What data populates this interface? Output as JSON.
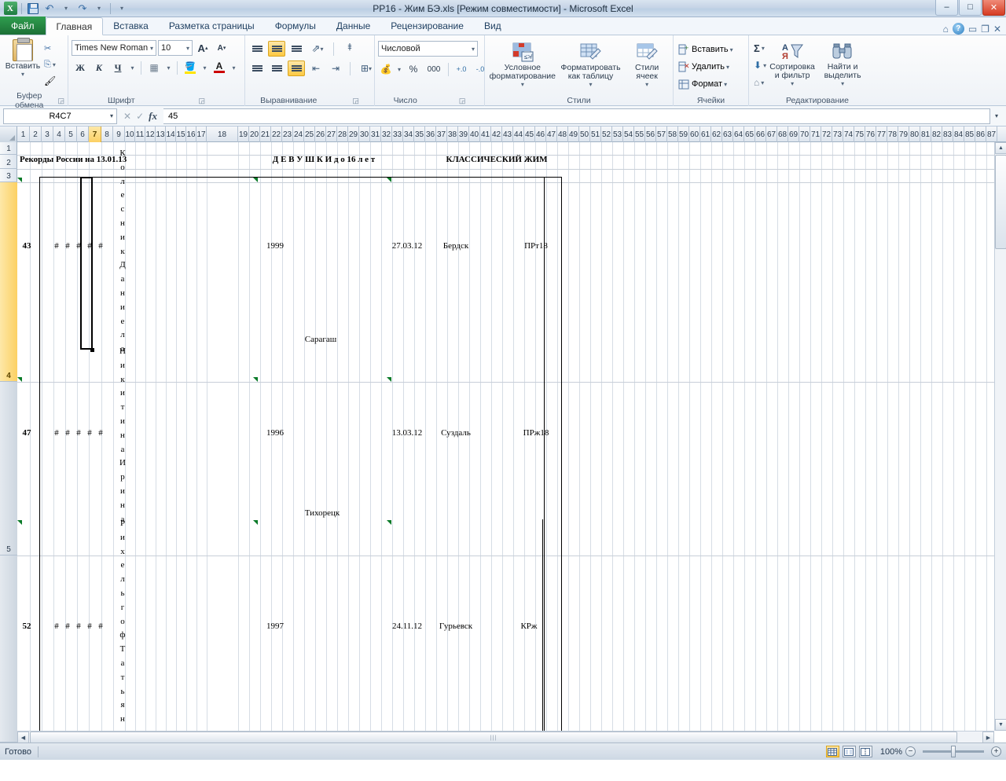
{
  "window": {
    "title": "PP16 - Жим БЭ.xls  [Режим совместимости]  -  Microsoft Excel",
    "minimize": "–",
    "maximize": "□",
    "close": "✕"
  },
  "quick_access": {
    "logo": "X",
    "save": "save-icon",
    "undo": "↶",
    "redo": "↷",
    "customize": "▾"
  },
  "tabs": [
    {
      "label": "Файл",
      "kind": "file"
    },
    {
      "label": "Главная",
      "kind": "active"
    },
    {
      "label": "Вставка",
      "kind": "normal"
    },
    {
      "label": "Разметка страницы",
      "kind": "normal"
    },
    {
      "label": "Формулы",
      "kind": "normal"
    },
    {
      "label": "Данные",
      "kind": "normal"
    },
    {
      "label": "Рецензирование",
      "kind": "normal"
    },
    {
      "label": "Вид",
      "kind": "normal"
    }
  ],
  "ribbon": {
    "clipboard": {
      "group_label": "Буфер обмена",
      "paste": "Вставить",
      "cut": "✂",
      "copy": "⎘",
      "format_painter": "🖌"
    },
    "font": {
      "group_label": "Шрифт",
      "font_name": "Times New Roman",
      "font_size": "10",
      "grow_font": "A",
      "shrink_font": "A",
      "bold": "Ж",
      "italic": "К",
      "underline": "Ч",
      "borders": "▦",
      "fill_color": "A",
      "font_color": "A"
    },
    "alignment": {
      "group_label": "Выравнивание",
      "align_top": "≡",
      "align_middle": "≡",
      "align_bottom": "≡",
      "orientation": "⇗",
      "align_left": "≡",
      "align_center": "≡",
      "align_right": "≡",
      "decrease_indent": "⇤",
      "increase_indent": "⇥",
      "wrap_text": "⮐",
      "merge_cells": "⊞"
    },
    "number": {
      "group_label": "Число",
      "format": "Числовой",
      "currency": "¤",
      "percent": "%",
      "comma": "000",
      "increase_decimal": "+.0",
      "decrease_decimal": "-.0"
    },
    "styles": {
      "group_label": "Стили",
      "conditional": "Условное форматирование",
      "as_table": "Форматировать как таблицу",
      "cell_styles": "Стили ячеек"
    },
    "cells": {
      "group_label": "Ячейки",
      "insert": "Вставить",
      "delete": "Удалить",
      "format": "Формат"
    },
    "editing": {
      "group_label": "Редактирование",
      "autosum": "Σ",
      "fill": "⬇",
      "clear": "⌫",
      "sort_filter": "Сортировка и фильтр",
      "find_select": "Найти и выделить"
    }
  },
  "formula_bar": {
    "name_box": "R4C7",
    "cancel": "✕",
    "enter": "✓",
    "fx": "fx",
    "value": "45",
    "expand": "▾"
  },
  "grid": {
    "column_headers": [
      "1",
      "2",
      "3",
      "4",
      "5",
      "6",
      "7",
      "8",
      "9",
      "10",
      "11",
      "12",
      "13",
      "14",
      "15",
      "16",
      "17",
      "18",
      "19",
      "20",
      "21",
      "22",
      "23",
      "24",
      "25",
      "26",
      "27",
      "28",
      "29",
      "30",
      "31",
      "32",
      "33",
      "34",
      "35",
      "36",
      "37",
      "38",
      "39",
      "40",
      "41",
      "42",
      "43",
      "44",
      "45",
      "46",
      "47",
      "48",
      "49",
      "50",
      "51",
      "52",
      "53",
      "54",
      "55",
      "56",
      "57",
      "58",
      "59",
      "60",
      "61",
      "62",
      "63",
      "64",
      "65",
      "66",
      "67",
      "68",
      "69",
      "70",
      "71",
      "72",
      "73",
      "74",
      "75",
      "76",
      "77",
      "78",
      "79",
      "80",
      "81",
      "82",
      "83",
      "84",
      "85",
      "86",
      "87"
    ],
    "selected_column": "7",
    "row_headers": [
      "1",
      "2",
      "3",
      "4",
      "5"
    ],
    "selected_row": "4",
    "cells": [
      {
        "text": "Рекорды России на 13.01.13",
        "row": 2,
        "align": "left",
        "bold": true,
        "size": 11
      },
      {
        "text": "Д Е В У Ш К И  д о  16  л е т",
        "row": 2,
        "align": "center",
        "bold": true,
        "size": 11
      },
      {
        "text": "КЛАССИЧЕСКИЙ ЖИМ",
        "row": 2,
        "align": "center",
        "bold": true,
        "size": 11
      },
      {
        "text": "43",
        "row": 4,
        "align": "center",
        "bold": true,
        "size": 11
      },
      {
        "text": "1999",
        "row": 4,
        "align": "center",
        "bold": false,
        "size": 11
      },
      {
        "text": "27.03.12",
        "row": 4,
        "align": "center",
        "bold": false,
        "size": 11
      },
      {
        "text": "Бердск",
        "row": 4,
        "align": "center",
        "bold": false,
        "size": 11
      },
      {
        "text": "ПРт18",
        "row": 4,
        "align": "center",
        "bold": false,
        "size": 11
      },
      {
        "text": "Сарагаш",
        "row": 4,
        "align": "center",
        "bold": false,
        "size": 11
      },
      {
        "text": "47",
        "row": 5,
        "align": "center",
        "bold": true,
        "size": 11
      },
      {
        "text": "1996",
        "row": 5,
        "align": "center",
        "bold": false,
        "size": 11
      },
      {
        "text": "13.03.12",
        "row": 5,
        "align": "center",
        "bold": false,
        "size": 11
      },
      {
        "text": "Суздаль",
        "row": 5,
        "align": "center",
        "bold": false,
        "size": 11
      },
      {
        "text": "ПРж18",
        "row": 5,
        "align": "center",
        "bold": false,
        "size": 11
      },
      {
        "text": "Тихорецк",
        "row": 5,
        "align": "center",
        "bold": false,
        "size": 11
      },
      {
        "text": "52",
        "row": 6,
        "align": "center",
        "bold": true,
        "size": 11
      },
      {
        "text": "1997",
        "row": 6,
        "align": "center",
        "bold": false,
        "size": 11
      },
      {
        "text": "24.11.12",
        "row": 6,
        "align": "center",
        "bold": false,
        "size": 11
      },
      {
        "text": "Гурьевск",
        "row": 6,
        "align": "center",
        "bold": false,
        "size": 11
      },
      {
        "text": "КРж",
        "row": 6,
        "align": "center",
        "bold": false,
        "size": 11
      }
    ],
    "row2": {
      "c1": "Рекорды России на 13.01.13",
      "c2": "Д Е В У Ш К И  д о  16  л е т",
      "c3": "КЛАССИЧЕСКИЙ ЖИМ"
    },
    "row4": {
      "weight": "43",
      "hash": "#",
      "name_vertical": "КолесникДаниела",
      "year": "1999",
      "city_extra": "Сарагаш",
      "date": "27.03.12",
      "place": "Бердск",
      "code": "ПРт18"
    },
    "row5": {
      "weight": "47",
      "hash": "#",
      "name_vertical": "НикитинаИрина",
      "year": "1996",
      "city_extra": "Тихорецк",
      "date": "13.03.12",
      "place": "Суздаль",
      "code": "ПРж18"
    },
    "row6": {
      "weight": "52",
      "hash": "#",
      "name_vertical": "РихельгофТатьян",
      "year": "1997",
      "date": "24.11.12",
      "place": "Гурьевск",
      "code": "КРж"
    }
  },
  "status_bar": {
    "mode": "Готово",
    "view_normal": "normal-view-icon",
    "view_layout": "page-layout-view-icon",
    "view_break": "page-break-view-icon",
    "zoom_level": "100%",
    "zoom_out": "−",
    "zoom_in": "+"
  }
}
